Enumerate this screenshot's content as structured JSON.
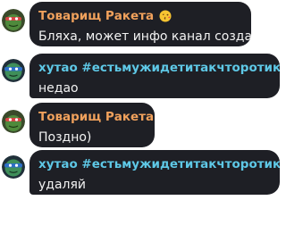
{
  "colors": {
    "bubble_bg": "#1e1f25",
    "name_orange": "#f0a15c",
    "name_teal": "#5ec8e6",
    "message_text": "#f2f2f2"
  },
  "messages": [
    {
      "author": "Товарищ Ракета",
      "author_emoji": "kissing-face-icon",
      "text": "Бляха, может инфо канал создать?..",
      "avatar": "turtle-avatar-icon"
    },
    {
      "author": "хутао #естьмужидетитакчторотикофф#...",
      "text": "недао",
      "avatar": "turtle-avatar-icon"
    },
    {
      "author": "Товарищ Ракета",
      "author_emoji": "kissing-face-icon",
      "text": "Поздно)",
      "avatar": "turtle-avatar-icon"
    },
    {
      "author": "хутао #естьмужидетитакчторотикофф#...",
      "text": "удаляй",
      "avatar": "turtle-avatar-icon"
    }
  ]
}
